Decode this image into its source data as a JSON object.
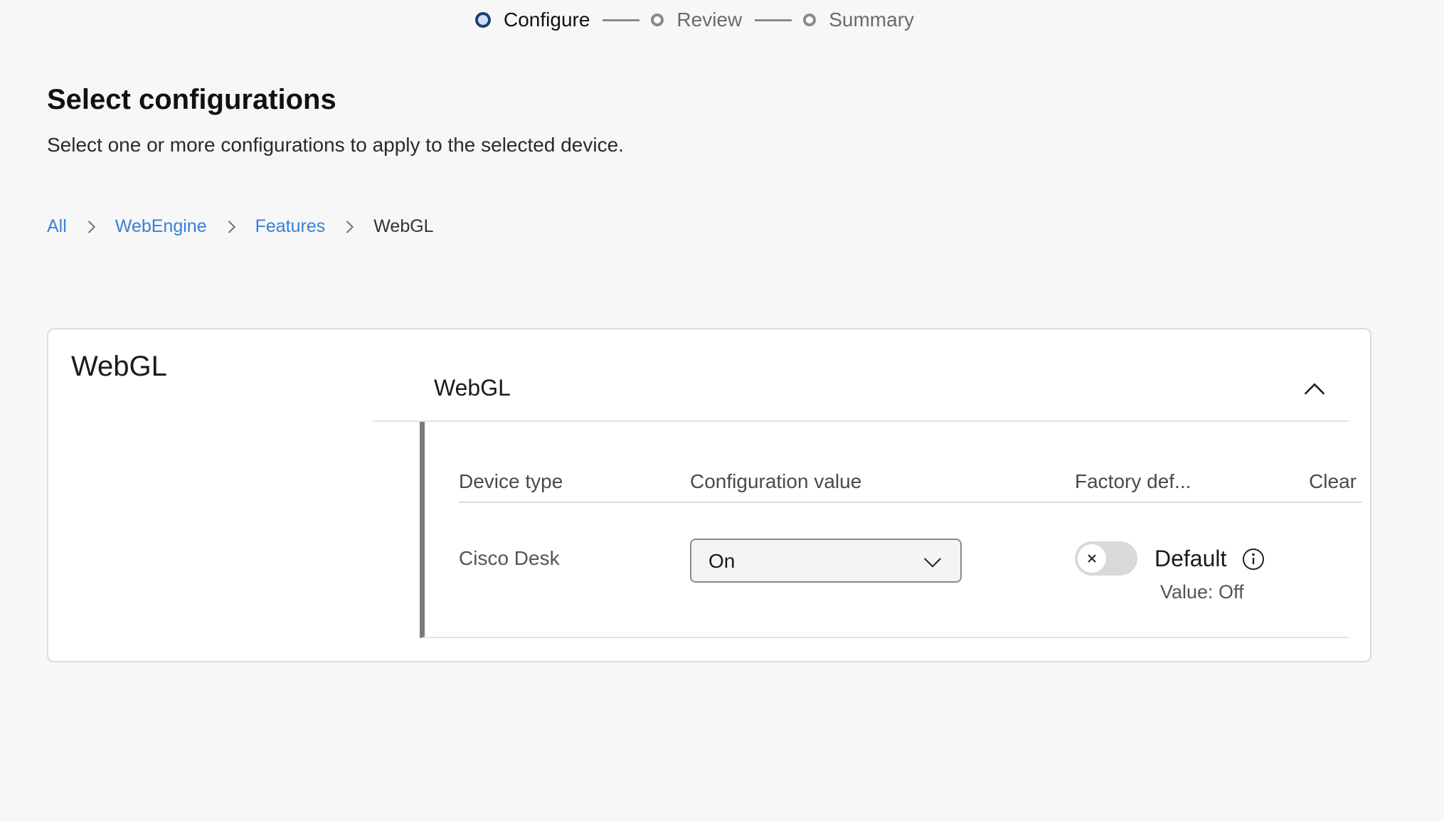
{
  "stepper": {
    "steps": [
      {
        "label": "Configure",
        "state": "active"
      },
      {
        "label": "Review",
        "state": "pending"
      },
      {
        "label": "Summary",
        "state": "pending"
      }
    ]
  },
  "header": {
    "title": "Select configurations",
    "subtitle": "Select one or more configurations to apply to the selected device."
  },
  "breadcrumb": {
    "items": [
      "All",
      "WebEngine",
      "Features"
    ],
    "current": "WebGL"
  },
  "card": {
    "side_title": "WebGL",
    "section": {
      "title": "WebGL",
      "expanded": true,
      "columns": {
        "device_type": "Device type",
        "config_value": "Configuration value",
        "factory_default": "Factory def...",
        "clear": "Clear"
      },
      "rows": [
        {
          "device_type": "Cisco Desk",
          "config_value": "On",
          "factory_toggle_on": false,
          "default_label": "Default",
          "default_value": "Value: Off"
        }
      ]
    }
  },
  "colors": {
    "accent_link": "#3a7fd5",
    "step_active": "#1d3f73",
    "background": "#f7f7f7"
  },
  "icons": {
    "breadcrumb_separator": "chevron-right-icon",
    "collapse": "chevron-up-icon",
    "select": "chevron-down-icon",
    "toggle_off": "x-icon",
    "info": "info-icon"
  }
}
